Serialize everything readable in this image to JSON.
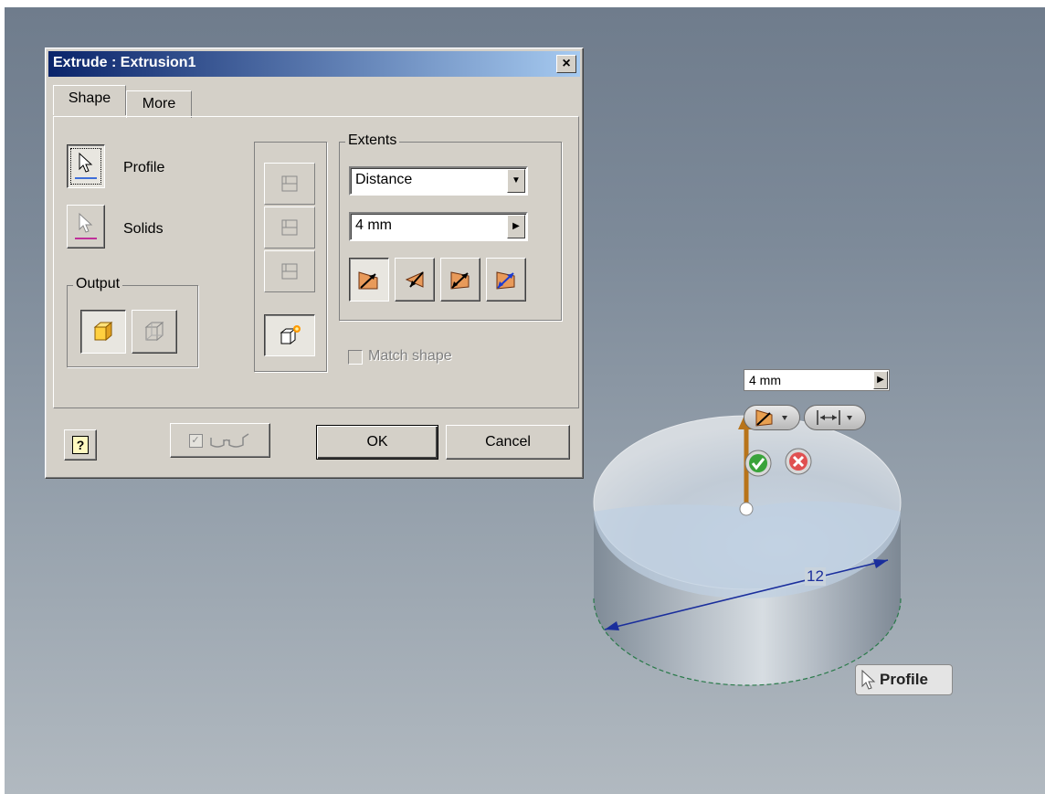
{
  "dialog": {
    "title": "Extrude : Extrusion1",
    "close_label": "×",
    "tabs": [
      {
        "label": "Shape"
      },
      {
        "label": "More"
      }
    ],
    "profile_label": "Profile",
    "solids_label": "Solids",
    "output_group": "Output",
    "extents_group": "Extents",
    "extents_type": "Distance",
    "distance_value": "4 mm",
    "match_shape_label": "Match shape",
    "ok_label": "OK",
    "cancel_label": "Cancel",
    "help_label": "?"
  },
  "minitoolbar": {
    "distance_value": "4 mm"
  },
  "viewport": {
    "dimension_label": "12",
    "profile_tooltip": "Profile"
  },
  "colors": {
    "title_bar_start": "#0a246a",
    "title_bar_end": "#a6caf0",
    "dialog_face": "#d4d0c8",
    "profile_accent": "#3f6fd8",
    "solids_accent": "#c0309a",
    "arrow": "#b8741a",
    "ok_green": "#3aa33a",
    "cancel_red": "#d83a3a",
    "dimension_blue": "#1a2e9c"
  }
}
